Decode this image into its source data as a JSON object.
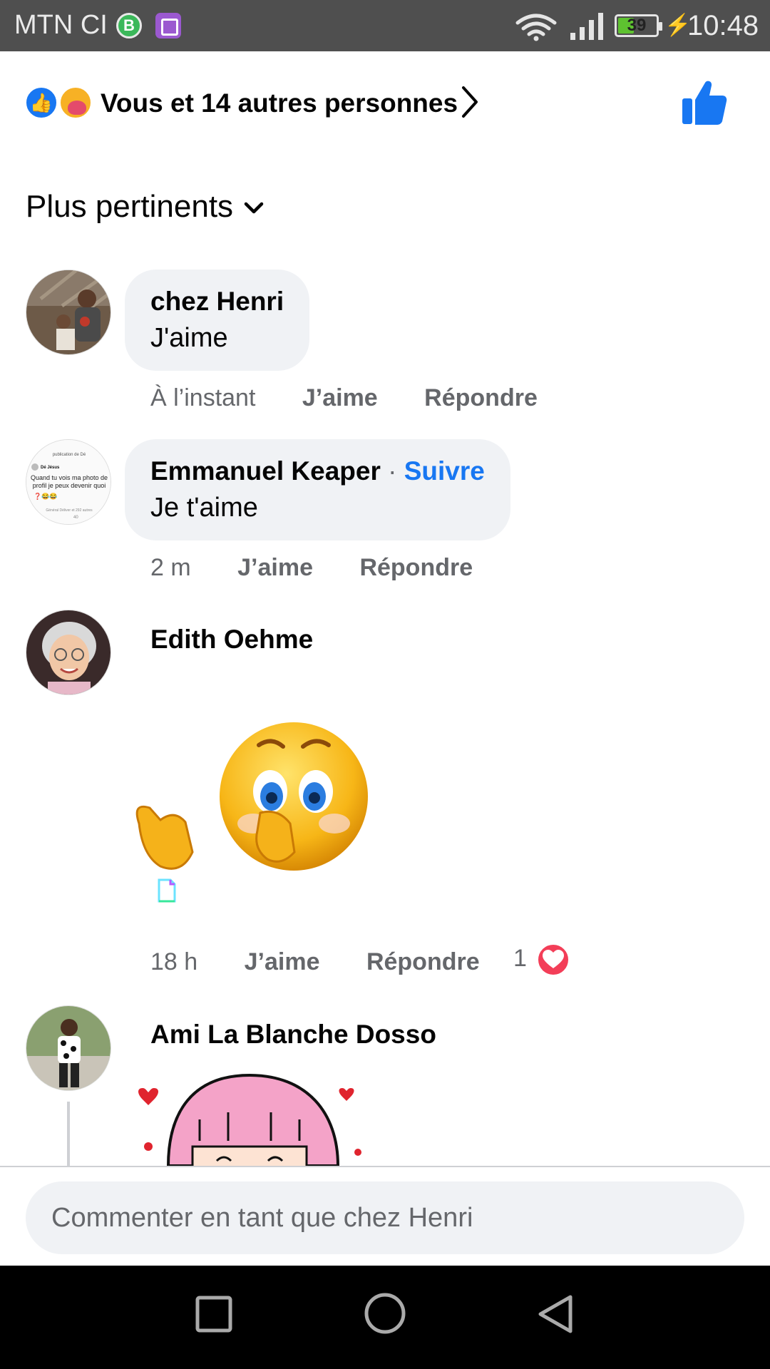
{
  "status_bar": {
    "carrier": "MTN CI",
    "whatsapp_badge": "B",
    "battery": "39",
    "battery_fraction": 0.39,
    "time": "10:48"
  },
  "reactions": {
    "summary": "Vous et 14 autres personnes",
    "icons": [
      "like-icon",
      "care-icon"
    ]
  },
  "sort": {
    "label": "Plus pertinents"
  },
  "comments": [
    {
      "author": "chez Henri",
      "text": "J'aime",
      "time": "À l’instant",
      "like_label": "J’aime",
      "reply_label": "Répondre"
    },
    {
      "author": "Emmanuel Keaper",
      "separator": "·",
      "follow_label": "Suivre",
      "text": "Je t'aime",
      "time": "2 m",
      "like_label": "J’aime",
      "reply_label": "Répondre",
      "avatar_text": {
        "header": "publication de Dé",
        "name": "Dé Jésus",
        "body": "Quand tu vois ma photo de profil je peux devenir quoi",
        "footer": "Général Déliver et 292 autres",
        "count": "40"
      }
    },
    {
      "author": "Edith Oehme",
      "sticker": "blushing-emoji-sticker",
      "time": "18 h",
      "like_label": "J’aime",
      "reply_label": "Répondre",
      "reaction_count": "1",
      "reaction_icon": "heart-icon"
    },
    {
      "author": "Ami La Blanche Dosso",
      "sticker": "pink-hair-girl-sticker"
    }
  ],
  "composer": {
    "placeholder": "Commenter en tant que chez Henri"
  },
  "colors": {
    "accent": "#1877f2",
    "bubble": "#f0f2f5",
    "meta_text": "#65676b",
    "heart": "#f33e58"
  }
}
